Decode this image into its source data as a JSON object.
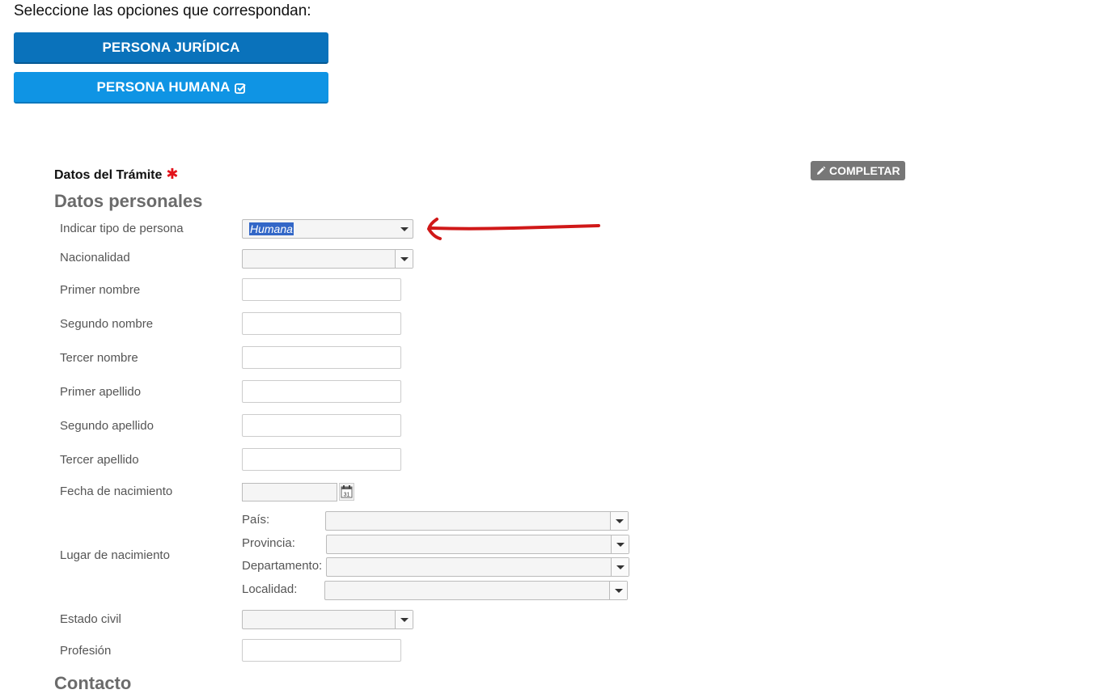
{
  "intro_text": "Seleccione las opciones que correspondan:",
  "person_type_buttons": {
    "juridica": "PERSONA JURÍDICA",
    "humana": "PERSONA HUMANA"
  },
  "section": {
    "title": "Datos del Trámite",
    "required_mark": "✱",
    "completar_label": "COMPLETAR"
  },
  "datos_personales": {
    "heading": "Datos personales",
    "tipo_persona": {
      "label": "Indicar tipo de persona",
      "value": "Humana"
    },
    "nacionalidad": {
      "label": "Nacionalidad",
      "value": ""
    },
    "primer_nombre": {
      "label": "Primer nombre",
      "value": ""
    },
    "segundo_nombre": {
      "label": "Segundo nombre",
      "value": ""
    },
    "tercer_nombre": {
      "label": "Tercer nombre",
      "value": ""
    },
    "primer_apellido": {
      "label": "Primer apellido",
      "value": ""
    },
    "segundo_apellido": {
      "label": "Segundo apellido",
      "value": ""
    },
    "tercer_apellido": {
      "label": "Tercer apellido",
      "value": ""
    },
    "fecha_nacimiento": {
      "label": "Fecha de nacimiento",
      "value": "",
      "calendar_day": "31"
    },
    "lugar_nacimiento": {
      "label": "Lugar de nacimiento",
      "pais": "País:",
      "provincia": "Provincia:",
      "departamento": "Departamento:",
      "localidad": "Localidad:"
    },
    "estado_civil": {
      "label": "Estado civil",
      "value": ""
    },
    "profesion": {
      "label": "Profesión",
      "value": ""
    }
  },
  "contacto": {
    "heading": "Contacto"
  },
  "icons": {
    "check": "check-square-icon",
    "pencil": "pencil-icon",
    "calendar": "calendar-icon",
    "dropdown": "chevron-down-icon"
  },
  "colors": {
    "juridica_button": "#0a72bb",
    "humana_button": "#0f94e4",
    "required": "#e3131b",
    "completar_button": "#777777",
    "annotation_arrow": "#d01818"
  }
}
